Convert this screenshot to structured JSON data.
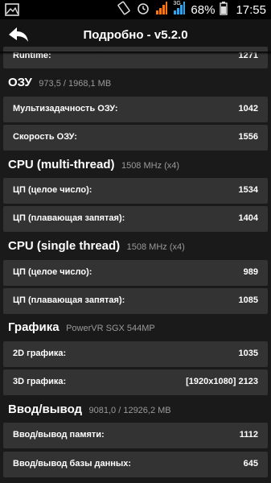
{
  "status_bar": {
    "battery_percent": "68%",
    "time": "17:55",
    "network": "3G"
  },
  "action_bar": {
    "title": "Подробно - v5.2.0"
  },
  "rows_top": {
    "runtime": {
      "label": "Runtime:",
      "value": "1271"
    }
  },
  "sections": [
    {
      "title": "ОЗУ",
      "subtitle": "973,5 / 1968,1 MB",
      "rows": [
        {
          "label": "Мультизадачность ОЗУ:",
          "value": "1042"
        },
        {
          "label": "Скорость ОЗУ:",
          "value": "1556"
        }
      ]
    },
    {
      "title": "CPU (multi-thread)",
      "subtitle": "1508 MHz (x4)",
      "rows": [
        {
          "label": "ЦП (целое число):",
          "value": "1534"
        },
        {
          "label": "ЦП (плавающая запятая):",
          "value": "1404"
        }
      ]
    },
    {
      "title": "CPU (single thread)",
      "subtitle": "1508 MHz (x4)",
      "rows": [
        {
          "label": "ЦП (целое число):",
          "value": "989"
        },
        {
          "label": "ЦП (плавающая запятая):",
          "value": "1085"
        }
      ]
    },
    {
      "title": "Графика",
      "subtitle": "PowerVR SGX 544MP",
      "rows": [
        {
          "label": "2D графика:",
          "value": "1035"
        },
        {
          "label": "3D графика:",
          "value": "[1920x1080] 2123"
        }
      ]
    },
    {
      "title": "Ввод/вывод",
      "subtitle": "9081,0 / 12926,2 MB",
      "rows": [
        {
          "label": "Ввод/вывод памяти:",
          "value": "1112"
        },
        {
          "label": "Ввод/вывод базы данных:",
          "value": "645"
        }
      ]
    }
  ],
  "colors": {
    "background": "#1a1a1a",
    "row_background": "#333333",
    "subtitle": "#9a9a9a",
    "signal_accent": "#f07b1e"
  }
}
